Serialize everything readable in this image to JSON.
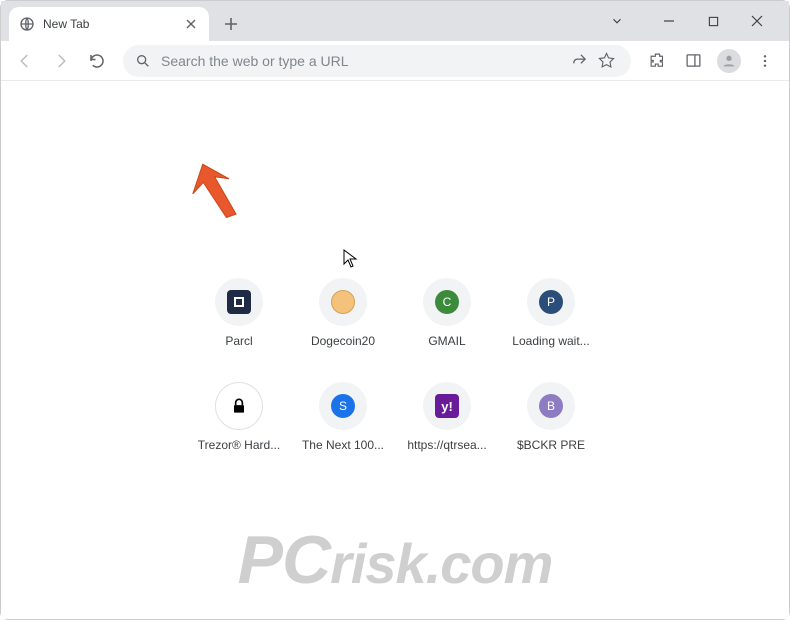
{
  "titlebar": {
    "tab_title": "New Tab"
  },
  "toolbar": {
    "omnibox_placeholder": "Search the web or type a URL"
  },
  "shortcuts": [
    {
      "label": "Parcl",
      "bg": "#1f2a44",
      "letter": "",
      "icon": "parcl"
    },
    {
      "label": "Dogecoin20",
      "bg": "#f4c27a",
      "letter": "",
      "icon": "doge"
    },
    {
      "label": "GMAIL",
      "bg": "#3c8a3c",
      "letter": "C",
      "icon": "letter"
    },
    {
      "label": "Loading wait...",
      "bg": "#2b4d7a",
      "letter": "P",
      "icon": "letter"
    },
    {
      "label": "Trezor® Hard...",
      "bg": "#ffffff",
      "letter": "",
      "icon": "lock"
    },
    {
      "label": "The Next 100...",
      "bg": "#1a73e8",
      "letter": "S",
      "icon": "letter"
    },
    {
      "label": "https://qtrsea...",
      "bg": "#6a1b9a",
      "letter": "",
      "icon": "yahoo"
    },
    {
      "label": "$BCKR PRE",
      "bg": "#8e7cc3",
      "letter": "B",
      "icon": "letter"
    }
  ],
  "watermark": {
    "text_p": "P",
    "text_c": "C",
    "text_rest": "risk.com"
  }
}
